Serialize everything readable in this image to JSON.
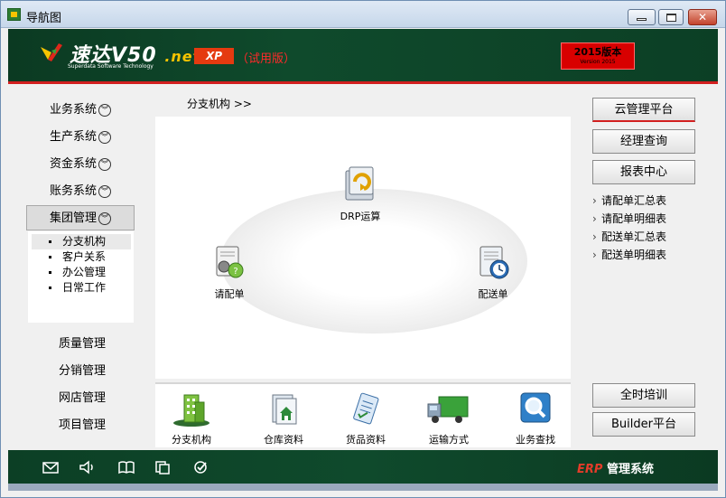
{
  "window": {
    "title": "导航图"
  },
  "header": {
    "brand_main": "速达V50",
    "brand_net": ".net",
    "tagline": "Superdata Software Technology",
    "edition": "XP",
    "trial": "（试用版）",
    "version_main": "2015版本",
    "version_sub": "Version 2015"
  },
  "left_nav": {
    "items": [
      {
        "label": "业务系统"
      },
      {
        "label": "生产系统"
      },
      {
        "label": "资金系统"
      },
      {
        "label": "账务系统"
      },
      {
        "label": "集团管理"
      }
    ],
    "sub_items": [
      {
        "label": "分支机构"
      },
      {
        "label": "客户关系"
      },
      {
        "label": "办公管理"
      },
      {
        "label": "日常工作"
      }
    ],
    "plain_items": [
      {
        "label": "质量管理"
      },
      {
        "label": "分销管理"
      },
      {
        "label": "网店管理"
      },
      {
        "label": "项目管理"
      }
    ]
  },
  "breadcrumb": {
    "text": "分支机构 >>"
  },
  "diagram": {
    "nodes": [
      {
        "label": "DRP运算",
        "icon": "refresh-icon"
      },
      {
        "label": "请配单",
        "icon": "gear-document-icon"
      },
      {
        "label": "配送单",
        "icon": "clock-document-icon"
      }
    ]
  },
  "bottom_tools": [
    {
      "label": "分支机构",
      "icon": "building-icon"
    },
    {
      "label": "仓库资料",
      "icon": "warehouse-icon"
    },
    {
      "label": "货品资料",
      "icon": "clipboard-icon"
    },
    {
      "label": "运输方式",
      "icon": "truck-icon"
    },
    {
      "label": "业务查找",
      "icon": "magnifier-icon"
    }
  ],
  "right_panel": {
    "buttons": [
      {
        "label": "云管理平台"
      },
      {
        "label": "经理查询"
      },
      {
        "label": "报表中心"
      }
    ],
    "links": [
      {
        "label": "请配单汇总表"
      },
      {
        "label": "请配单明细表"
      },
      {
        "label": "配送单汇总表"
      },
      {
        "label": "配送单明细表"
      }
    ],
    "bottom_buttons": [
      {
        "label": "全时培训"
      },
      {
        "label": "Builder平台"
      }
    ]
  },
  "footer": {
    "erp_prefix": "ERP",
    "erp_label": "管理系统",
    "icons": [
      "mail-icon",
      "speaker-icon",
      "book-icon",
      "copy-icon",
      "check-circle-icon"
    ]
  }
}
